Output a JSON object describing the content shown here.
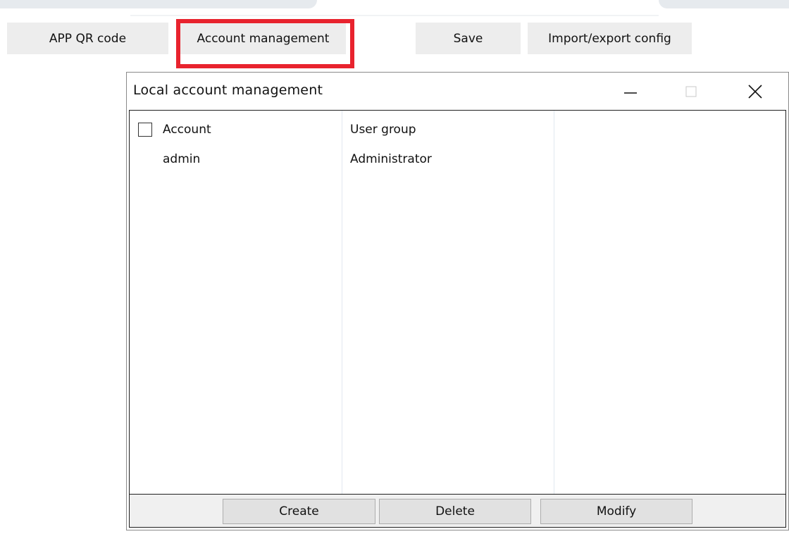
{
  "toolbar": {
    "app_qr_label": "APP QR code",
    "account_management_label": "Account management",
    "save_label": "Save",
    "import_export_label": "Import/export config",
    "highlight_color": "#e8232e"
  },
  "dialog": {
    "title": "Local account management",
    "controls": {
      "minimize_icon": "minimize-icon",
      "maximize_icon": "maximize-icon",
      "close_icon": "close-icon"
    },
    "table": {
      "columns": [
        "Account",
        "User group"
      ],
      "rows": [
        {
          "account": "admin",
          "user_group": "Administrator"
        }
      ]
    },
    "buttons": {
      "create": "Create",
      "delete": "Delete",
      "modify": "Modify"
    }
  }
}
